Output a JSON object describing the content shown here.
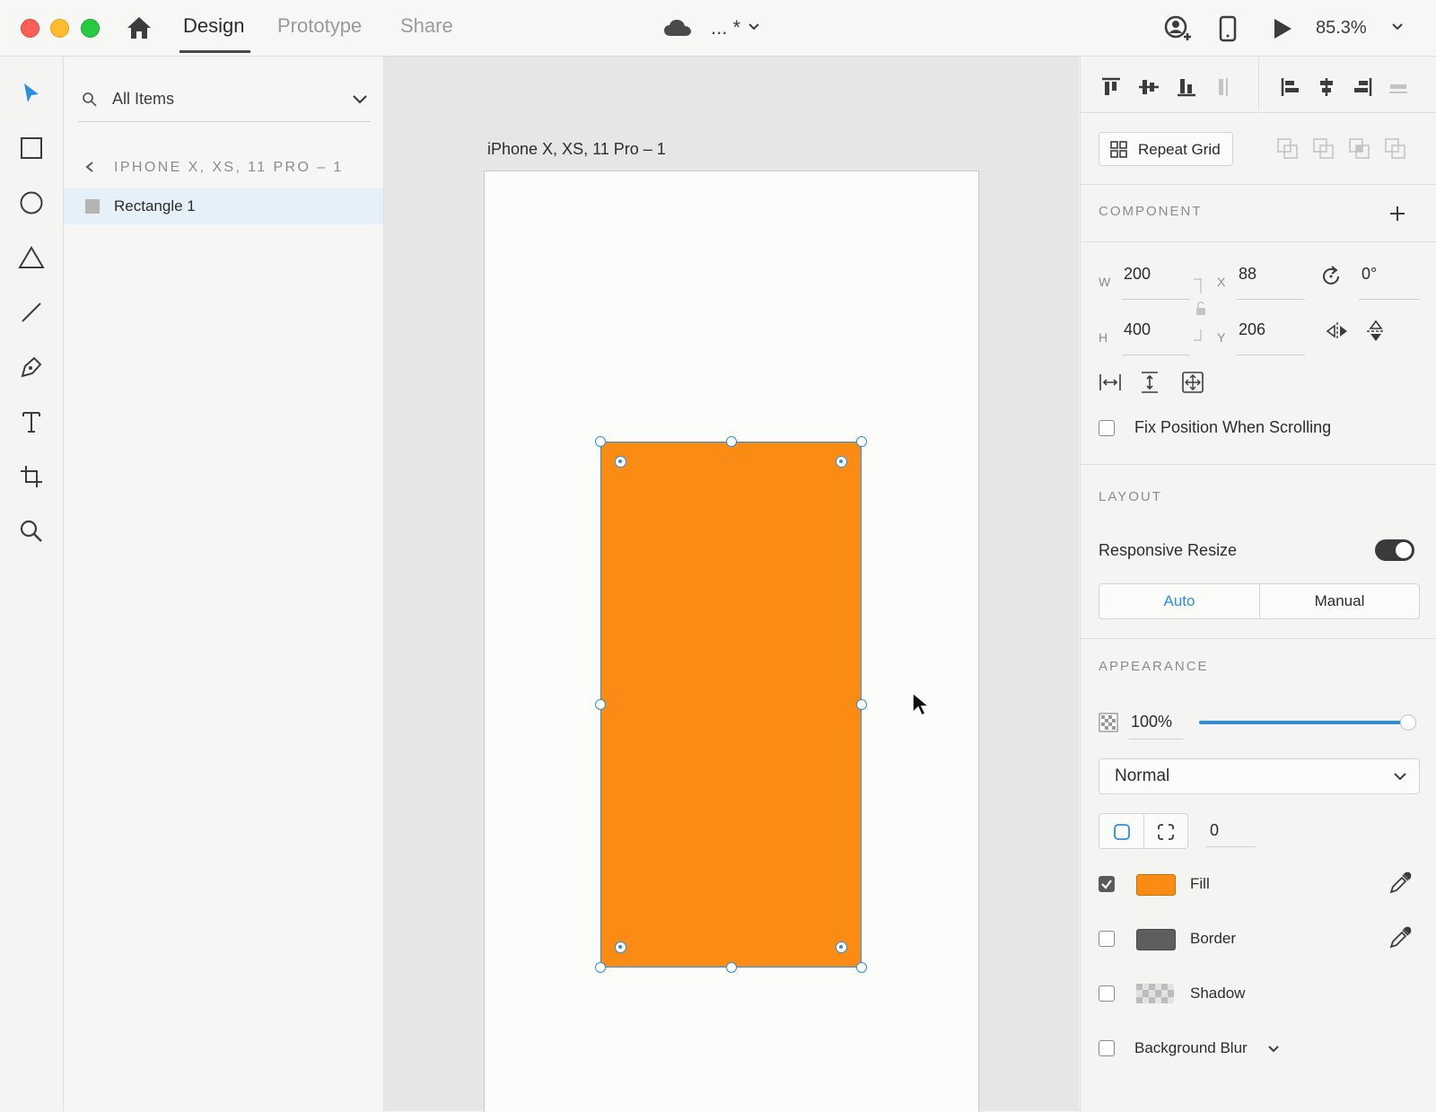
{
  "window": {
    "tabs": [
      {
        "label": "Design",
        "active": true
      },
      {
        "label": "Prototype",
        "active": false
      },
      {
        "label": "Share",
        "active": false
      }
    ],
    "doc_title": "... *",
    "zoom": "85.3%"
  },
  "layers": {
    "filter_label": "All Items",
    "breadcrumb": "IPHONE X, XS, 11 PRO – 1",
    "items": [
      {
        "label": "Rectangle 1",
        "selected": true
      }
    ]
  },
  "canvas": {
    "artboard_title": "iPhone X, XS, 11 Pro – 1",
    "fill_color": "#fa8c16",
    "selection_color": "#2e8ede"
  },
  "inspector": {
    "repeat_grid_label": "Repeat Grid",
    "component_title": "COMPONENT",
    "w_label": "W",
    "w_value": "200",
    "h_label": "H",
    "h_value": "400",
    "x_label": "X",
    "x_value": "88",
    "y_label": "Y",
    "y_value": "206",
    "rotation_value": "0°",
    "fix_position_label": "Fix Position When Scrolling",
    "layout_title": "LAYOUT",
    "responsive_label": "Responsive Resize",
    "responsive_on": true,
    "auto_label": "Auto",
    "manual_label": "Manual",
    "appearance_title": "APPEARANCE",
    "opacity_value": "100%",
    "opacity_level": 1.0,
    "blend_mode": "Normal",
    "corner_value": "0",
    "fill_label": "Fill",
    "fill_checked": true,
    "border_label": "Border",
    "border_checked": false,
    "shadow_label": "Shadow",
    "shadow_checked": false,
    "blur_label": "Background Blur",
    "blur_checked": false
  }
}
